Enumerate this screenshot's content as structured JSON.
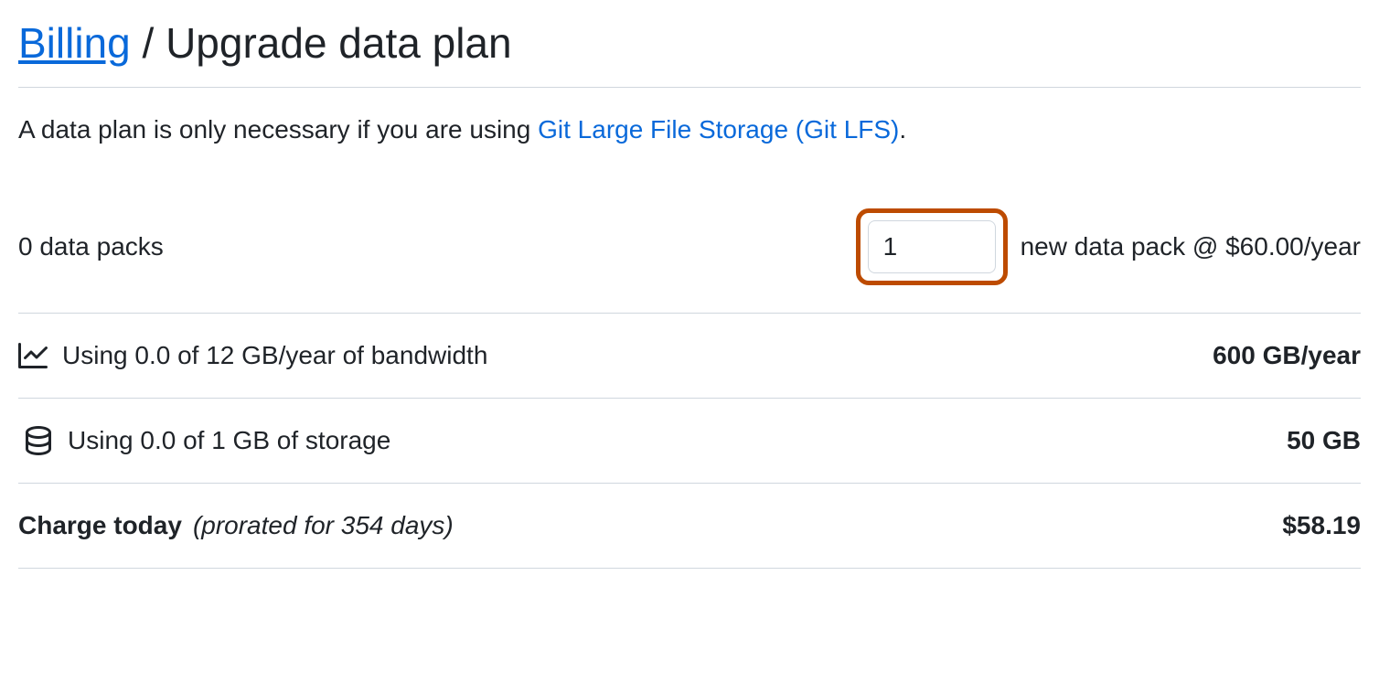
{
  "header": {
    "billing_link": "Billing",
    "separator": " / ",
    "title": "Upgrade data plan"
  },
  "description": {
    "prefix": "A data plan is only necessary if you are using ",
    "link_text": "Git Large File Storage (Git LFS)",
    "suffix": "."
  },
  "packs": {
    "current": "0 data packs",
    "input_value": "1",
    "price_label": "new data pack @ $60.00/year"
  },
  "bandwidth": {
    "usage": "Using 0.0 of 12 GB/year of bandwidth",
    "total": "600 GB/year"
  },
  "storage": {
    "usage": "Using 0.0 of 1 GB of storage",
    "total": "50 GB"
  },
  "charge": {
    "label": "Charge today",
    "note": "(prorated for 354 days)",
    "amount": "$58.19"
  }
}
